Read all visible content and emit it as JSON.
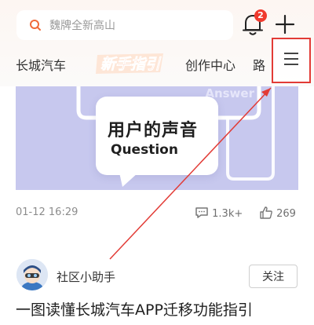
{
  "search": {
    "placeholder": "魏牌全新高山",
    "icon": "search-icon"
  },
  "header": {
    "notification_count": "2",
    "bell_icon": "bell-icon",
    "add_icon": "plus-icon"
  },
  "tabs": [
    {
      "label": "长城汽车"
    },
    {
      "label": "新手指引"
    },
    {
      "label": "创作中心"
    },
    {
      "label": "路"
    }
  ],
  "menu": {
    "icon": "menu-icon"
  },
  "post1": {
    "banner_answer": "Answer",
    "banner_title": "用户的声音",
    "banner_subtitle": "Question",
    "date": "01-12 16:29",
    "comments": "1.3k+",
    "likes": "269"
  },
  "post2": {
    "author": "社区小助手",
    "follow_label": "关注",
    "title": "一图读懂长城汽车APP迁移功能指引"
  },
  "colors": {
    "accent_red": "#e23b36",
    "badge_red": "#f03a2e",
    "banner_bg": "#c7c8ee"
  }
}
